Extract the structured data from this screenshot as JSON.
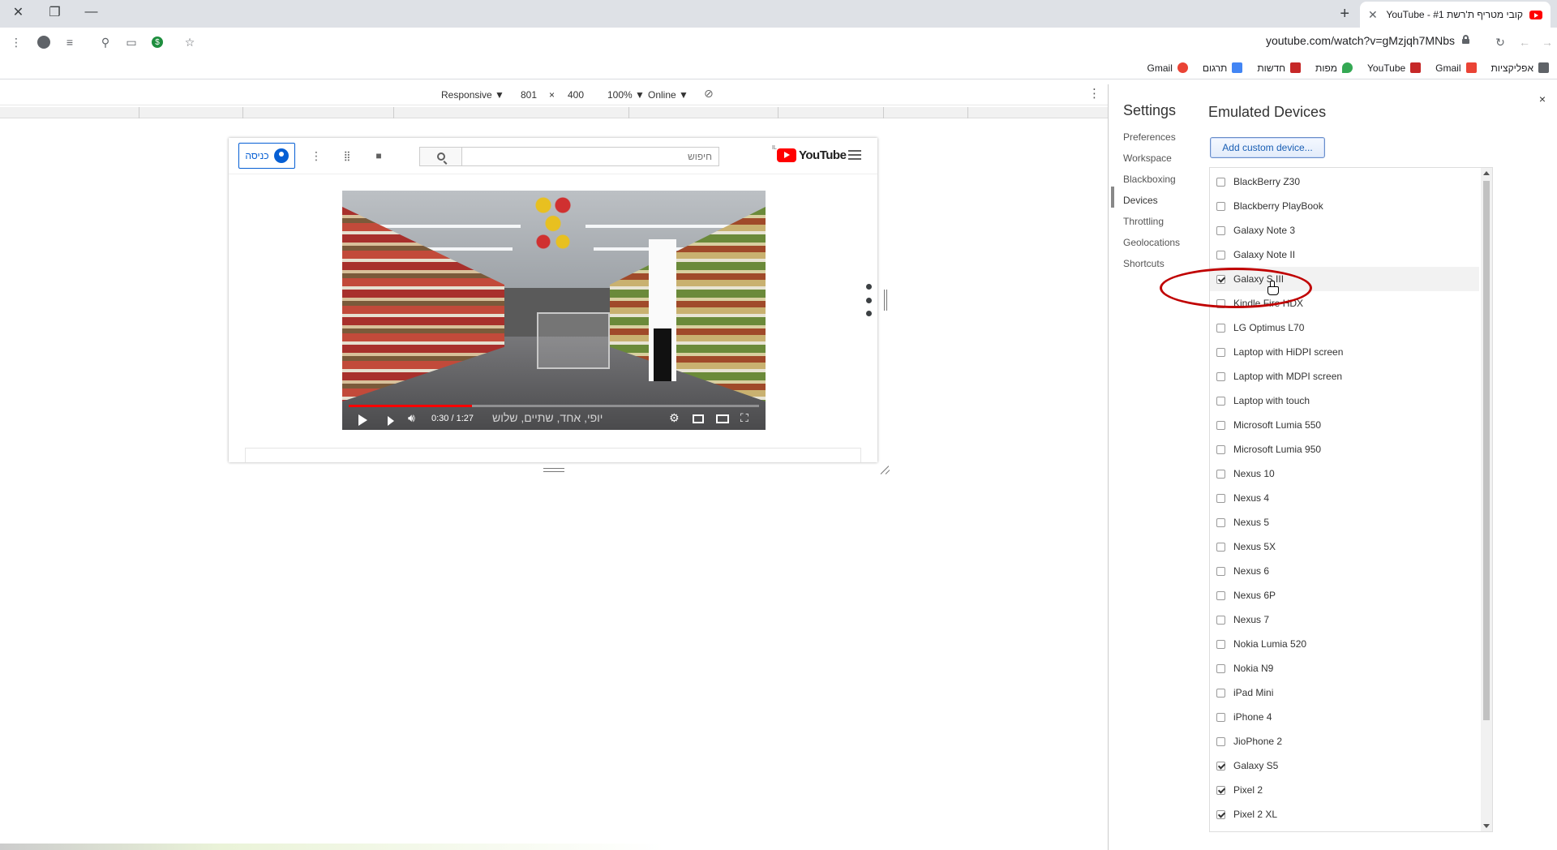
{
  "browser": {
    "tab_title": "קובי מטריף ת'רשת #1 - YouTube",
    "url": "youtube.com/watch?v=gMzjqh7MNbs",
    "bookmarks": [
      {
        "label": "אפליקציות",
        "color": "#5f6368"
      },
      {
        "label": "Gmail",
        "color": "#ea4335"
      },
      {
        "label": "YouTube",
        "color": "#c62828"
      },
      {
        "label": "מפות",
        "color": "#34a853"
      },
      {
        "label": "חדשות",
        "color": "#c62828"
      },
      {
        "label": "תרגום",
        "color": "#4285f4"
      },
      {
        "label": "Gmail",
        "color": "#ea4335"
      }
    ]
  },
  "devtools": {
    "device_toolbar": {
      "mode": "Responsive ▼",
      "width": "801",
      "times": "×",
      "height": "400",
      "zoom": "100% ▼",
      "network": "Online ▼"
    },
    "settings": {
      "title": "Settings",
      "close": "×",
      "nav": [
        "Preferences",
        "Workspace",
        "Blackboxing",
        "Devices",
        "Throttling",
        "Geolocations",
        "Shortcuts"
      ],
      "active_nav": "Devices",
      "section_title": "Emulated Devices",
      "add_button": "Add custom device...",
      "devices": [
        {
          "name": "BlackBerry Z30",
          "checked": false
        },
        {
          "name": "Blackberry PlayBook",
          "checked": false
        },
        {
          "name": "Galaxy Note 3",
          "checked": false
        },
        {
          "name": "Galaxy Note II",
          "checked": false
        },
        {
          "name": "Galaxy S III",
          "checked": true
        },
        {
          "name": "Kindle Fire HDX",
          "checked": false
        },
        {
          "name": "LG Optimus L70",
          "checked": false
        },
        {
          "name": "Laptop with HiDPI screen",
          "checked": false
        },
        {
          "name": "Laptop with MDPI screen",
          "checked": false
        },
        {
          "name": "Laptop with touch",
          "checked": false
        },
        {
          "name": "Microsoft Lumia 550",
          "checked": false
        },
        {
          "name": "Microsoft Lumia 950",
          "checked": false
        },
        {
          "name": "Nexus 10",
          "checked": false
        },
        {
          "name": "Nexus 4",
          "checked": false
        },
        {
          "name": "Nexus 5",
          "checked": false
        },
        {
          "name": "Nexus 5X",
          "checked": false
        },
        {
          "name": "Nexus 6",
          "checked": false
        },
        {
          "name": "Nexus 6P",
          "checked": false
        },
        {
          "name": "Nexus 7",
          "checked": false
        },
        {
          "name": "Nokia Lumia 520",
          "checked": false
        },
        {
          "name": "Nokia N9",
          "checked": false
        },
        {
          "name": "iPad Mini",
          "checked": false
        },
        {
          "name": "iPhone 4",
          "checked": false
        },
        {
          "name": "JioPhone 2",
          "checked": false
        },
        {
          "name": "Galaxy S5",
          "checked": true
        },
        {
          "name": "Pixel 2",
          "checked": true
        },
        {
          "name": "Pixel 2 XL",
          "checked": true
        }
      ]
    }
  },
  "youtube": {
    "signin_label": "כניסה",
    "search_placeholder": "חיפוש",
    "logo_text": "YouTube",
    "logo_region": "IL",
    "video": {
      "time": "0:30 / 1:27",
      "subtitle": "יופי, אחד, שתיים, שלוש",
      "progress": 0.3
    }
  }
}
